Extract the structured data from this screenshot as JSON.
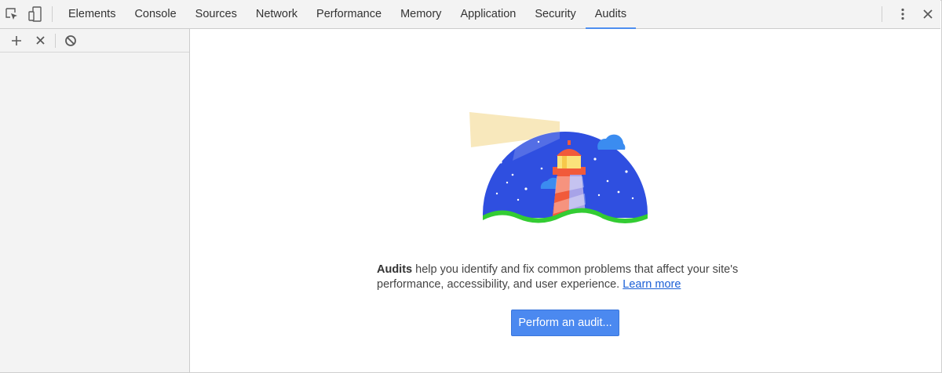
{
  "tabs": {
    "items": [
      {
        "label": "Elements"
      },
      {
        "label": "Console"
      },
      {
        "label": "Sources"
      },
      {
        "label": "Network"
      },
      {
        "label": "Performance"
      },
      {
        "label": "Memory"
      },
      {
        "label": "Application"
      },
      {
        "label": "Security"
      },
      {
        "label": "Audits"
      }
    ],
    "active": "Audits"
  },
  "icons": {
    "inspect": "inspect-element-icon",
    "device": "device-toolbar-icon",
    "menu": "kebab-menu-icon",
    "close": "close-icon",
    "add": "plus-icon",
    "remove": "x-icon",
    "clear": "block-icon"
  },
  "main": {
    "message_bold": "Audits",
    "message_text": " help you identify and fix common problems that affect your site's performance, accessibility, and user experience. ",
    "learn_more": "Learn more",
    "button_label": "Perform an audit..."
  },
  "colors": {
    "accent": "#4b89f0",
    "tab_indicator": "#4d8ef0",
    "link": "#1a5fd6",
    "sky": "#2f4fe0",
    "hill": "#33cc33",
    "tower_red": "#f15a3a",
    "lamp": "#fbe27a"
  }
}
